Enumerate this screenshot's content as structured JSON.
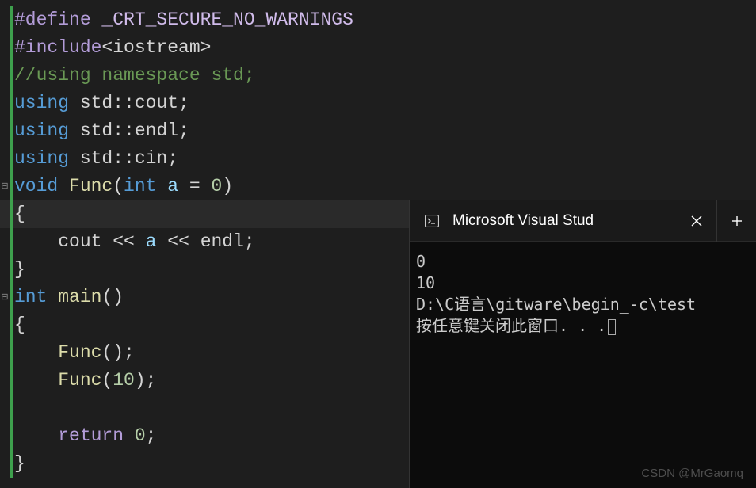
{
  "code": {
    "define_tokens": [
      {
        "t": "#define ",
        "c": "keyword-purple"
      },
      {
        "t": "_CRT_SECURE_NO_WARNINGS",
        "c": "header-name"
      }
    ],
    "include_tokens": [
      {
        "t": "#include",
        "c": "keyword-purple"
      },
      {
        "t": "<iostream>",
        "c": "angle"
      }
    ],
    "comment": "//using namespace std;",
    "using1": [
      {
        "t": "using ",
        "c": "keyword"
      },
      {
        "t": "std",
        "c": "identifier"
      },
      {
        "t": "::",
        "c": "operator"
      },
      {
        "t": "cout",
        "c": "identifier"
      },
      {
        "t": ";",
        "c": "operator"
      }
    ],
    "using2": [
      {
        "t": "using ",
        "c": "keyword"
      },
      {
        "t": "std",
        "c": "identifier"
      },
      {
        "t": "::",
        "c": "operator"
      },
      {
        "t": "endl",
        "c": "identifier"
      },
      {
        "t": ";",
        "c": "operator"
      }
    ],
    "using3": [
      {
        "t": "using ",
        "c": "keyword"
      },
      {
        "t": "std",
        "c": "identifier"
      },
      {
        "t": "::",
        "c": "operator"
      },
      {
        "t": "cin",
        "c": "identifier"
      },
      {
        "t": ";",
        "c": "operator"
      }
    ],
    "func_sig": [
      {
        "t": "void ",
        "c": "keyword"
      },
      {
        "t": "Func",
        "c": "function"
      },
      {
        "t": "(",
        "c": "paren"
      },
      {
        "t": "int ",
        "c": "keyword"
      },
      {
        "t": "a",
        "c": "variable"
      },
      {
        "t": " = ",
        "c": "operator"
      },
      {
        "t": "0",
        "c": "number"
      },
      {
        "t": ")",
        "c": "paren"
      }
    ],
    "brace_open": "{",
    "cout_line": [
      {
        "t": "    cout ",
        "c": "identifier"
      },
      {
        "t": "<< ",
        "c": "operator"
      },
      {
        "t": "a ",
        "c": "variable"
      },
      {
        "t": "<< ",
        "c": "operator"
      },
      {
        "t": "endl",
        "c": "identifier"
      },
      {
        "t": ";",
        "c": "operator"
      }
    ],
    "brace_close": "}",
    "main_sig": [
      {
        "t": "int ",
        "c": "keyword"
      },
      {
        "t": "main",
        "c": "function"
      },
      {
        "t": "()",
        "c": "paren"
      }
    ],
    "main_body": [
      [
        {
          "t": "    Func",
          "c": "function"
        },
        {
          "t": "()",
          "c": "paren"
        },
        {
          "t": ";",
          "c": "operator"
        }
      ],
      [
        {
          "t": "    Func",
          "c": "function"
        },
        {
          "t": "(",
          "c": "paren"
        },
        {
          "t": "10",
          "c": "number"
        },
        {
          "t": ")",
          "c": "paren"
        },
        {
          "t": ";",
          "c": "operator"
        }
      ]
    ],
    "return_line": [
      {
        "t": "    ",
        "c": "identifier"
      },
      {
        "t": "return ",
        "c": "keyword-purple"
      },
      {
        "t": "0",
        "c": "number"
      },
      {
        "t": ";",
        "c": "operator"
      }
    ]
  },
  "console": {
    "title": "Microsoft Visual Stud",
    "output": [
      "0",
      "10",
      "",
      "D:\\C语言\\gitware\\begin_-c\\test",
      "按任意键关闭此窗口. . ."
    ]
  },
  "collapse_marker": "⊟",
  "watermark": "CSDN @MrGaomq"
}
